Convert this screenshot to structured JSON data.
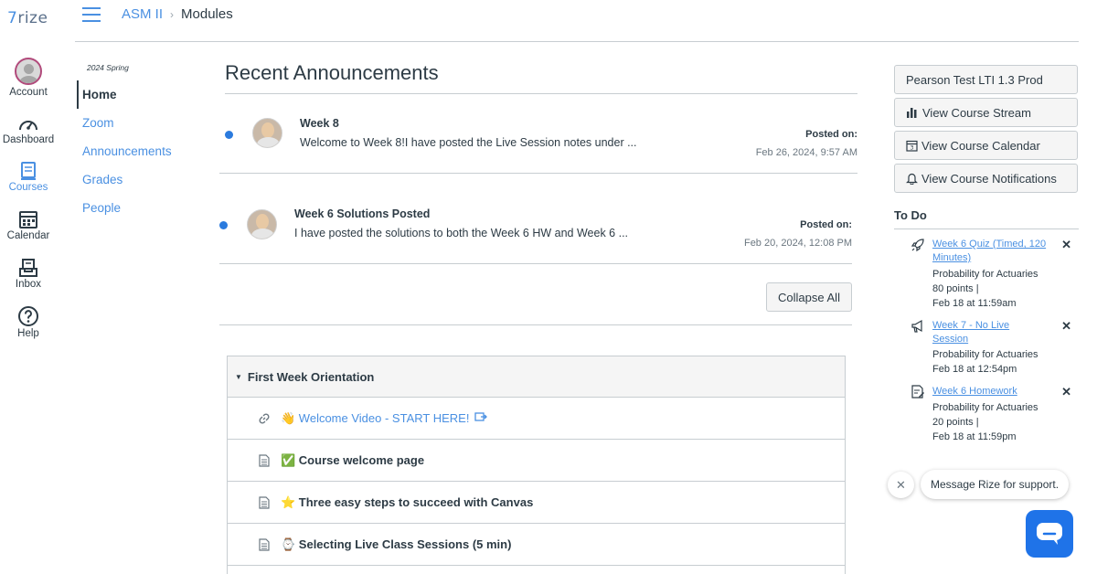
{
  "brand": {
    "logo_mark": "7",
    "logo_text": "rize"
  },
  "global_nav": {
    "account": "Account",
    "dashboard": "Dashboard",
    "courses": "Courses",
    "calendar": "Calendar",
    "inbox": "Inbox",
    "help": "Help"
  },
  "breadcrumb": {
    "course": "ASM II",
    "separator": "›",
    "page": "Modules"
  },
  "course_nav": {
    "term": "2024 Spring",
    "items": [
      "Home",
      "Zoom",
      "Announcements",
      "Grades",
      "People"
    ]
  },
  "announcements": {
    "title": "Recent Announcements",
    "posted_label": "Posted on:",
    "items": [
      {
        "title": "Week 8",
        "body": "Welcome to Week 8!I have posted the Live Session notes under ...",
        "date": "Feb 26, 2024, 9:57 AM"
      },
      {
        "title": "Week 6 Solutions Posted",
        "body": "I have posted the solutions to both the Week 6 HW and Week 6 ...",
        "date": "Feb 20, 2024, 12:08 PM"
      }
    ],
    "collapse_all": "Collapse All"
  },
  "module": {
    "title": "First Week Orientation",
    "items": [
      {
        "label": "👋 Welcome Video - START HERE!",
        "icon": "link-icon"
      },
      {
        "label": "✅ Course welcome page",
        "icon": "page-icon"
      },
      {
        "label": "⭐ Three easy steps to succeed with Canvas",
        "icon": "page-icon"
      },
      {
        "label": "⌚ Selecting Live Class Sessions (5 min)",
        "icon": "page-icon"
      }
    ]
  },
  "sidebar": {
    "buttons": {
      "lti": "Pearson Test LTI 1.3 Prod",
      "stream": "View Course Stream",
      "calendar": "View Course Calendar",
      "notifications": "View Course Notifications"
    },
    "todo_title": "To Do",
    "todo": [
      {
        "title": "Week 6 Quiz (Timed, 120 Minutes)",
        "course": "Probability for Actuaries",
        "points": "80 points  |",
        "due": "Feb 18 at 11:59am",
        "icon": "rocket-icon"
      },
      {
        "title": "Week 7 - No Live Session",
        "course": "Probability for Actuaries",
        "due": "Feb 18 at 12:54pm",
        "icon": "megaphone-icon"
      },
      {
        "title": "Week 6 Homework",
        "course": "Probability for Actuaries",
        "points": "20 points  |",
        "due": "Feb 18 at 11:59pm",
        "icon": "assignment-icon"
      }
    ],
    "dismiss": "✕"
  },
  "chat": {
    "close": "✕",
    "message": "Message Rize for support."
  },
  "colors": {
    "link": "#4a90e2",
    "text": "#2d3b45",
    "unread_dot": "#2b7bde",
    "chat": "#1f73e8"
  }
}
